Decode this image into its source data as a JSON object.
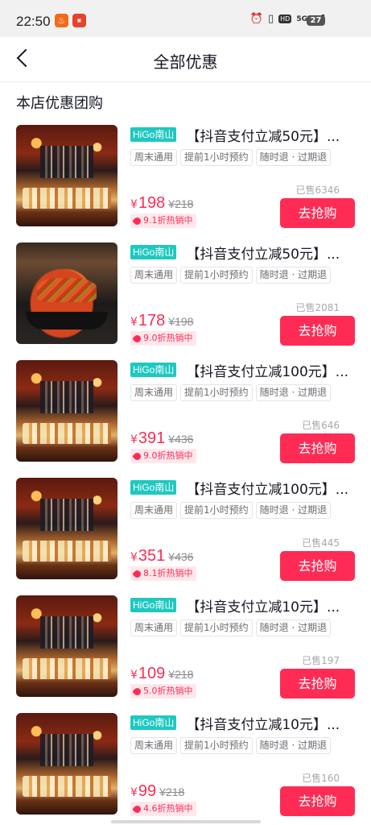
{
  "status_bar": {
    "time": "22:50",
    "network": "5G",
    "hd": "HD",
    "battery": "27"
  },
  "header": {
    "title": "全部优惠"
  },
  "section_title": "本店优惠团购",
  "colors": {
    "accent": "#fe2c55",
    "brand_badge": "#1ec8c0",
    "discount_bg": "#ffe8ec"
  },
  "deals": [
    {
      "brand": "HiGo南山",
      "title": "【抖音支付立减50元】...",
      "chips": [
        "周末通用",
        "提前1小时预约",
        "随时退 · 过期退"
      ],
      "sold": "已售6346",
      "currency": "¥",
      "price": "198",
      "original_price": "¥218",
      "discount": "9.1折热销中",
      "buy_label": "去抢购",
      "thumb": "a"
    },
    {
      "brand": "HiGo南山",
      "title": "【抖音支付立减50元】...",
      "chips": [
        "周末通用",
        "提前1小时预约",
        "随时退 · 过期退"
      ],
      "sold": "已售2081",
      "currency": "¥",
      "price": "178",
      "original_price": "¥198",
      "discount": "9.0折热销中",
      "buy_label": "去抢购",
      "thumb": "b"
    },
    {
      "brand": "HiGo南山",
      "title": "【抖音支付立减100元】...",
      "chips": [
        "周末通用",
        "提前1小时预约",
        "随时退 · 过期退"
      ],
      "sold": "已售646",
      "currency": "¥",
      "price": "391",
      "original_price": "¥436",
      "discount": "9.0折热销中",
      "buy_label": "去抢购",
      "thumb": "a"
    },
    {
      "brand": "HiGo南山",
      "title": "【抖音支付立减100元】...",
      "chips": [
        "周末通用",
        "提前1小时预约",
        "随时退 · 过期退"
      ],
      "sold": "已售445",
      "currency": "¥",
      "price": "351",
      "original_price": "¥436",
      "discount": "8.1折热销中",
      "buy_label": "去抢购",
      "thumb": "a"
    },
    {
      "brand": "HiGo南山",
      "title": "【抖音支付立减10元】...",
      "chips": [
        "周末通用",
        "提前1小时预约",
        "随时退 · 过期退"
      ],
      "sold": "已售197",
      "currency": "¥",
      "price": "109",
      "original_price": "¥218",
      "discount": "5.0折热销中",
      "buy_label": "去抢购",
      "thumb": "a"
    },
    {
      "brand": "HiGo南山",
      "title": "【抖音支付立减10元】...",
      "chips": [
        "周末通用",
        "提前1小时预约",
        "随时退 · 过期退"
      ],
      "sold": "已售160",
      "currency": "¥",
      "price": "99",
      "original_price": "¥218",
      "discount": "4.6折热销中",
      "buy_label": "去抢购",
      "thumb": "a"
    }
  ]
}
